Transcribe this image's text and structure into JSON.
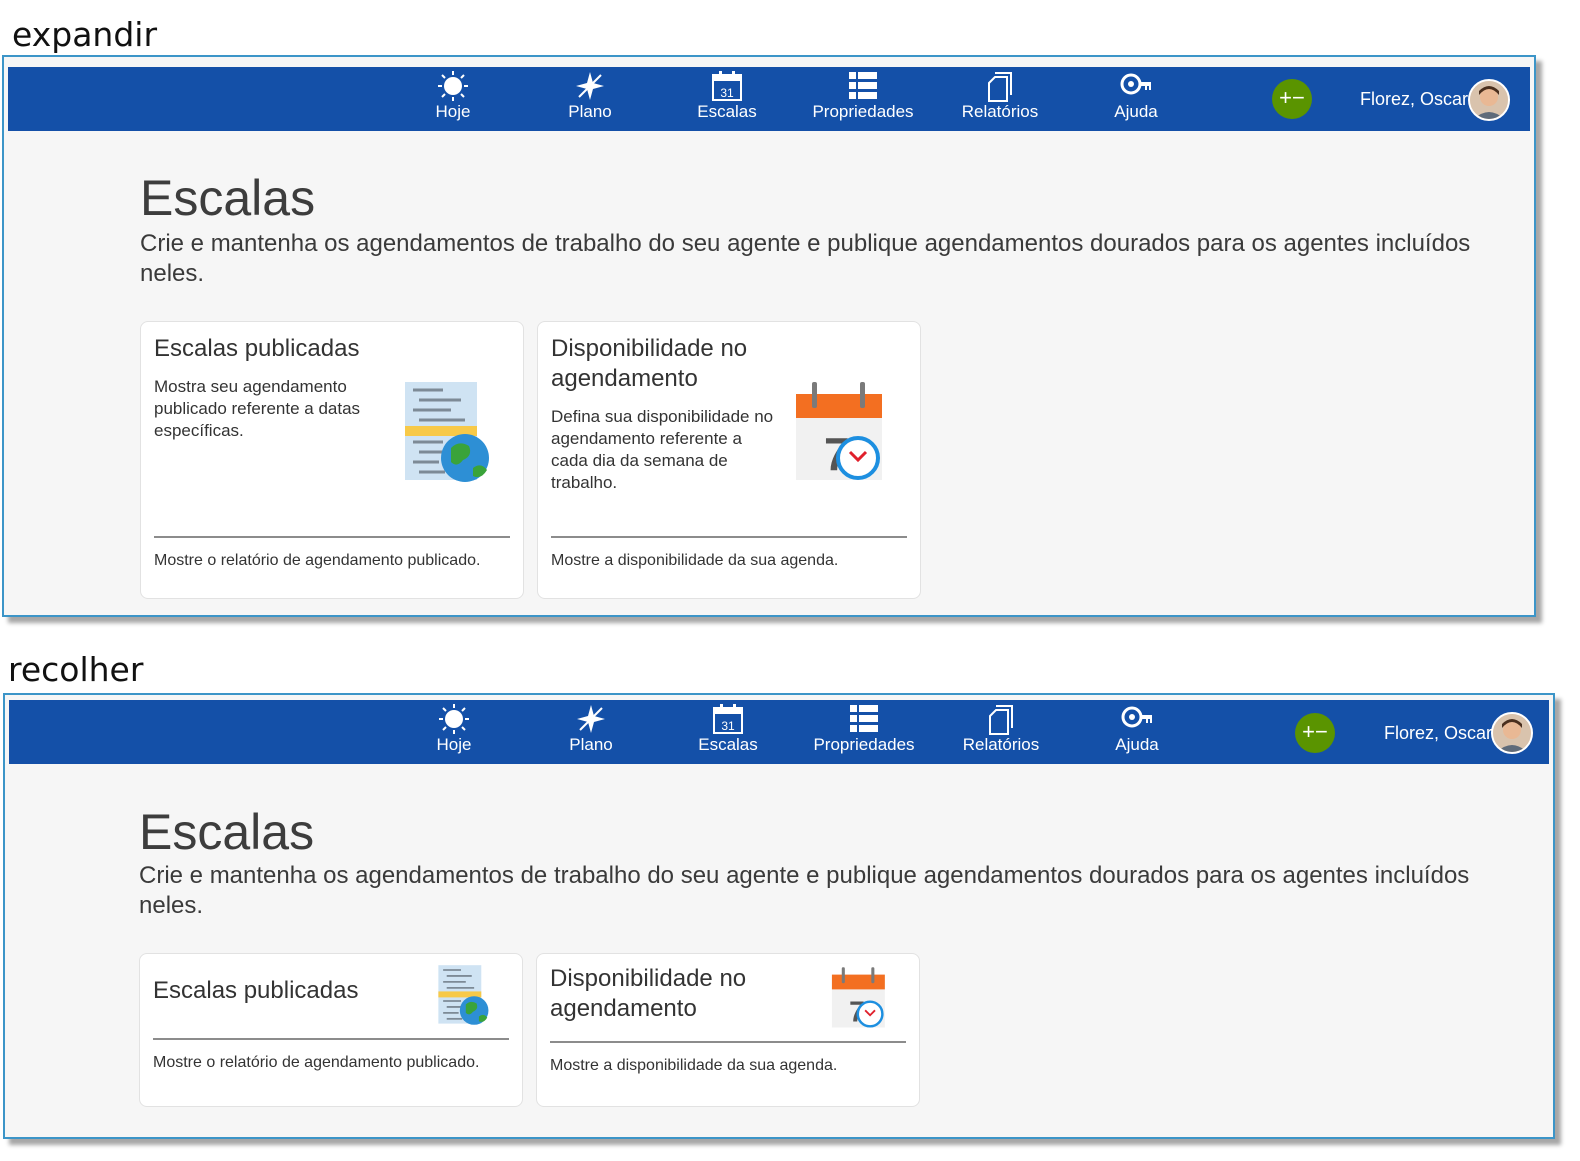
{
  "labels": {
    "expand": "expandir",
    "collapse": "recolher"
  },
  "nav": [
    {
      "id": "hoje",
      "label": "Hoje",
      "icon": "sun-icon"
    },
    {
      "id": "plano",
      "label": "Plano",
      "icon": "compass-icon"
    },
    {
      "id": "escalas",
      "label": "Escalas",
      "icon": "calendar-icon",
      "icon_text": "31"
    },
    {
      "id": "propriedades",
      "label": "Propriedades",
      "icon": "list-icon"
    },
    {
      "id": "relatorios",
      "label": "Relatórios",
      "icon": "documents-icon"
    },
    {
      "id": "ajuda",
      "label": "Ajuda",
      "icon": "help-key-icon"
    }
  ],
  "toggle": {
    "label": "+−",
    "icon": "plus-minus-icon",
    "color": "#5a9400"
  },
  "user": {
    "name": "Florez, Oscar",
    "icon": "avatar"
  },
  "page": {
    "title": "Escalas",
    "description": "Crie e mantenha os agendamentos de trabalho do seu agente e publique agendamentos dourados para os agentes incluídos neles."
  },
  "cards": [
    {
      "title": "Escalas publicadas",
      "description": "Mostra seu agendamento publicado referente a datas específicas.",
      "link": "Mostre o relatório de agendamento publicado.",
      "icon": "published-schedule-globe-icon"
    },
    {
      "title": "Disponibilidade no agendamento",
      "description": "Defina sua disponibilidade no agendamento referente a cada dia da semana de trabalho.",
      "link": "Mostre a disponibilidade da sua agenda.",
      "icon": "calendar-clock-icon"
    }
  ],
  "colors": {
    "topbar": "#1450a8",
    "frame_border": "#3c95c8",
    "background": "#f6f6f6"
  }
}
